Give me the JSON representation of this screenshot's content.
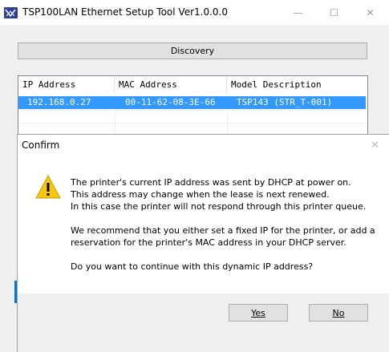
{
  "main_window": {
    "title": "TSP100LAN Ethernet Setup Tool Ver1.0.0.0",
    "controls": {
      "minimize": "—",
      "maximize": "☐",
      "close": "✕"
    },
    "discovery_label": "Discovery",
    "list": {
      "columns": [
        "IP Address",
        "MAC Address",
        "Model Description"
      ],
      "rows": [
        {
          "ip": "192.168.0.27",
          "mac": "00-11-62-08-3E-66",
          "model": "TSP143 (STR_T-001)",
          "selected": true
        }
      ]
    }
  },
  "confirm_dialog": {
    "title": "Confirm",
    "close_glyph": "✕",
    "icon": "warning-icon",
    "message_lines": [
      "The printer's current IP address was sent by DHCP at power on.",
      "This address may change when the lease is next renewed.",
      "In this case the printer will not respond through this printer queue.",
      "We recommend that you either set a fixed IP for the printer, or add a",
      "reservation for the printer's MAC address in your DHCP server.",
      "Do you want to continue with this dynamic IP address?"
    ],
    "yes_label": "Yes",
    "no_label": "No"
  },
  "colors": {
    "selection": "#3399ff",
    "warning": "#f9c80e",
    "accent": "#0078d7"
  }
}
